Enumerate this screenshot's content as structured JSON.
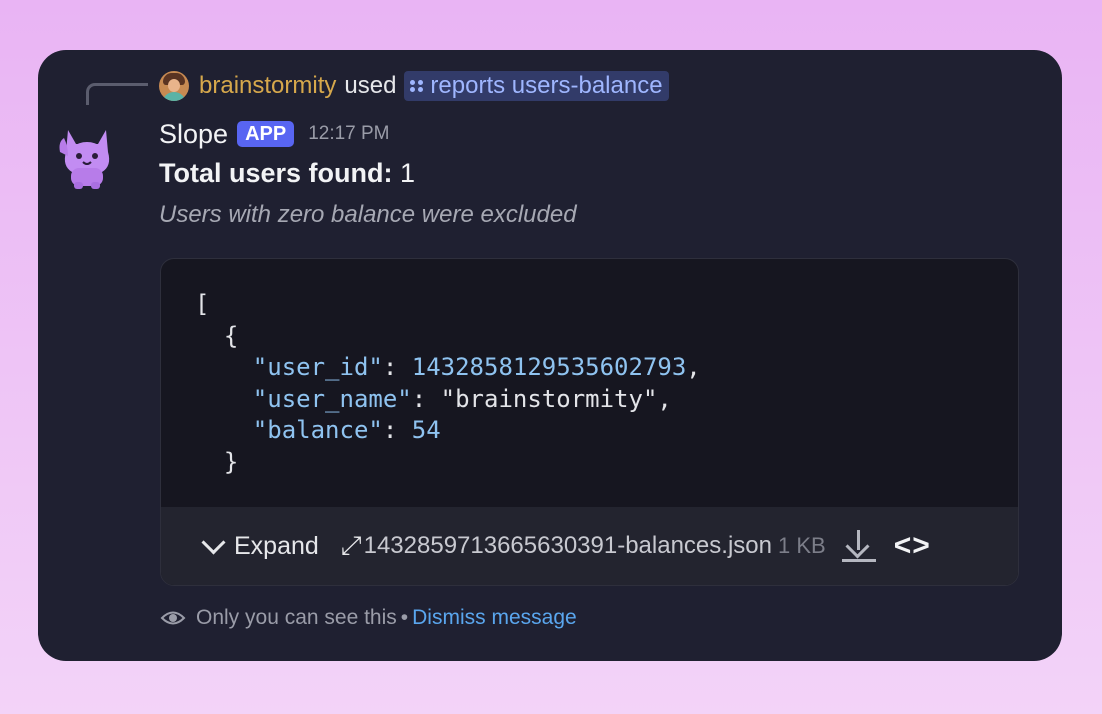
{
  "reply": {
    "user": "brainstormity",
    "used": "used",
    "command": "reports users-balance"
  },
  "message": {
    "bot_name": "Slope",
    "badge": "APP",
    "time": "12:17 PM",
    "total_label": "Total users found:",
    "total_value": "1",
    "subtitle": "Users with zero balance were excluded"
  },
  "attachment": {
    "code": {
      "open_bracket": "[",
      "open_brace": "{",
      "key_user_id": "\"user_id\"",
      "val_user_id": "1432858129535602793",
      "key_user_name": "\"user_name\"",
      "val_user_name": "\"brainstormity\"",
      "key_balance": "\"balance\"",
      "val_balance": "54",
      "close_brace": "}"
    },
    "expand_label": "Expand",
    "filename": "1432859713665630391-balances.json",
    "filesize": "1 KB"
  },
  "notice": {
    "text": "Only you can see this",
    "separator": "•",
    "dismiss": "Dismiss message"
  },
  "colors": {
    "card_bg": "#1f2031",
    "username": "#d6a84c",
    "command_bg": "#323b69",
    "command_text": "#9fb6ff",
    "app_badge": "#5865f2",
    "link": "#5aa6ee",
    "code_value": "#8fc3f0"
  }
}
